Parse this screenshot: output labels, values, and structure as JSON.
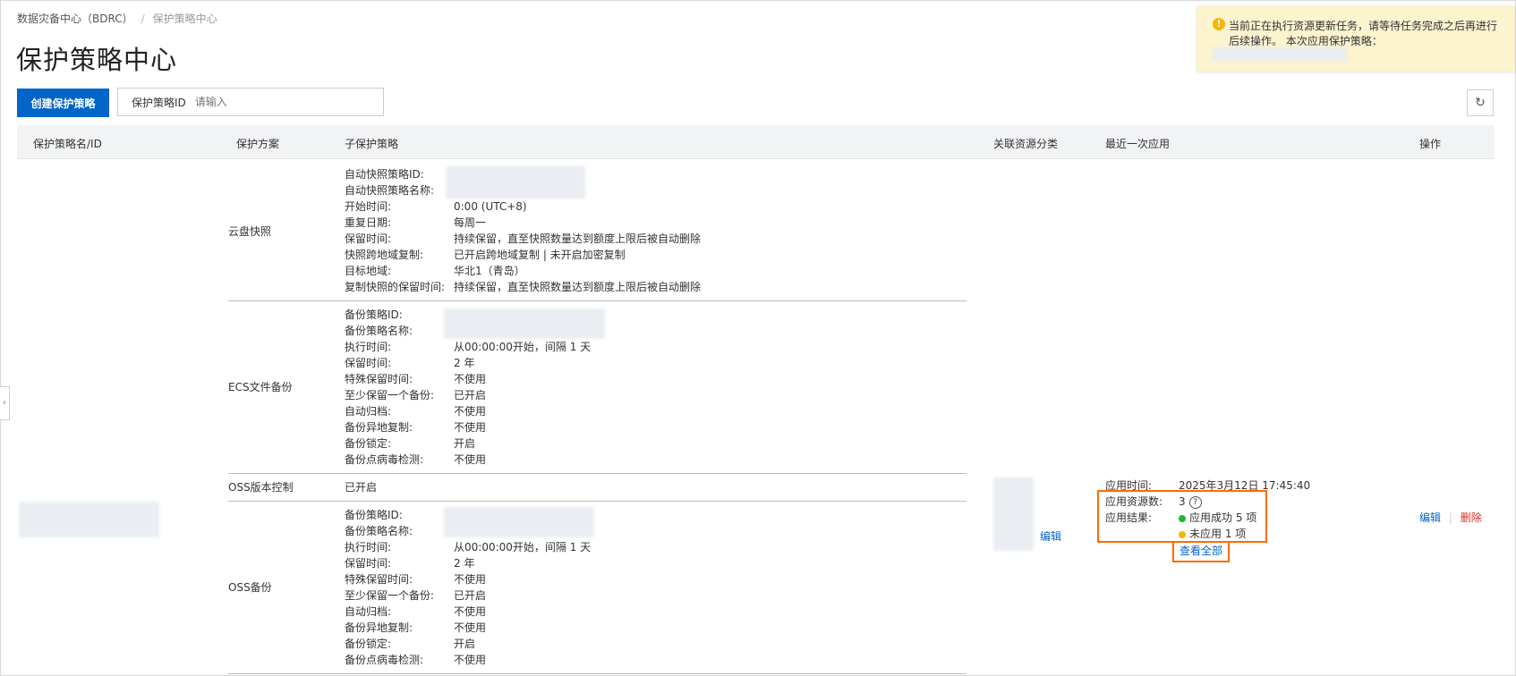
{
  "breadcrumb": {
    "root": "数据灾备中心（BDRC）",
    "sep": "/",
    "current": "保护策略中心"
  },
  "page_title": "保护策略中心",
  "toolbar": {
    "create_label": "创建保护策略",
    "search_label": "保护策略ID",
    "search_placeholder": "请输入",
    "refresh_icon": "refresh-icon"
  },
  "table": {
    "headers": [
      "保护策略名/ID",
      "保护方案",
      "子保护策略",
      "关联资源分类",
      "最近一次应用",
      "操作"
    ],
    "schemes": {
      "snapshot": {
        "name": "云盘快照",
        "items": [
          {
            "k": "自动快照策略ID:",
            "v": ""
          },
          {
            "k": "自动快照策略名称:",
            "v": ""
          },
          {
            "k": "开始时间:",
            "v": "0:00 (UTC+8)"
          },
          {
            "k": "重复日期:",
            "v": "每周一"
          },
          {
            "k": "保留时间:",
            "v": "持续保留，直至快照数量达到额度上限后被自动删除"
          },
          {
            "k": "快照跨地域复制:",
            "v": "已开启跨地域复制 | 未开启加密复制"
          },
          {
            "k": "目标地域:",
            "v": "华北1（青岛）"
          },
          {
            "k": "复制快照的保留时间:",
            "v": "持续保留，直至快照数量达到额度上限后被自动删除"
          }
        ]
      },
      "ecs": {
        "name": "ECS文件备份",
        "items": [
          {
            "k": "备份策略ID:",
            "v": ""
          },
          {
            "k": "备份策略名称:",
            "v": ""
          },
          {
            "k": "执行时间:",
            "v": "从00:00:00开始，间隔 1 天"
          },
          {
            "k": "保留时间:",
            "v": "2 年"
          },
          {
            "k": "特殊保留时间:",
            "v": "不使用"
          },
          {
            "k": "至少保留一个备份:",
            "v": "已开启"
          },
          {
            "k": "自动归档:",
            "v": "不使用"
          },
          {
            "k": "备份异地复制:",
            "v": "不使用"
          },
          {
            "k": "备份锁定:",
            "v": "开启"
          },
          {
            "k": "备份点病毒检测:",
            "v": "不使用"
          }
        ]
      },
      "ossver": {
        "name": "OSS版本控制",
        "value": "已开启"
      },
      "oss": {
        "name": "OSS备份",
        "items": [
          {
            "k": "备份策略ID:",
            "v": ""
          },
          {
            "k": "备份策略名称:",
            "v": ""
          },
          {
            "k": "执行时间:",
            "v": "从00:00:00开始，间隔 1 天"
          },
          {
            "k": "保留时间:",
            "v": "2 年"
          },
          {
            "k": "特殊保留时间:",
            "v": "不使用"
          },
          {
            "k": "至少保留一个备份:",
            "v": "已开启"
          },
          {
            "k": "自动归档:",
            "v": "不使用"
          },
          {
            "k": "备份异地复制:",
            "v": "不使用"
          },
          {
            "k": "备份锁定:",
            "v": "开启"
          },
          {
            "k": "备份点病毒检测:",
            "v": "不使用"
          }
        ]
      }
    },
    "resource": {
      "edit_label": "编辑"
    },
    "last_apply": {
      "time_label": "应用时间:",
      "time_value": "2025年3月12日 17:45:40",
      "count_label": "应用资源数:",
      "count_value": "3",
      "result_label": "应用结果:",
      "success_text": "应用成功 5 项",
      "pending_text": "未应用 1 项",
      "view_all": "查看全部"
    },
    "actions": {
      "edit": "编辑",
      "sep": "|",
      "delete": "删除"
    }
  },
  "toast": {
    "text": "当前正在执行资源更新任务，请等待任务完成之后再进行后续操作。 本次应用保护策略："
  },
  "colors": {
    "primary": "#0064c8",
    "danger": "#d93026",
    "success": "#1fb82b",
    "warning": "#f5b800",
    "highlight": "#ff6a00",
    "toast_bg": "#fcf3cf"
  }
}
